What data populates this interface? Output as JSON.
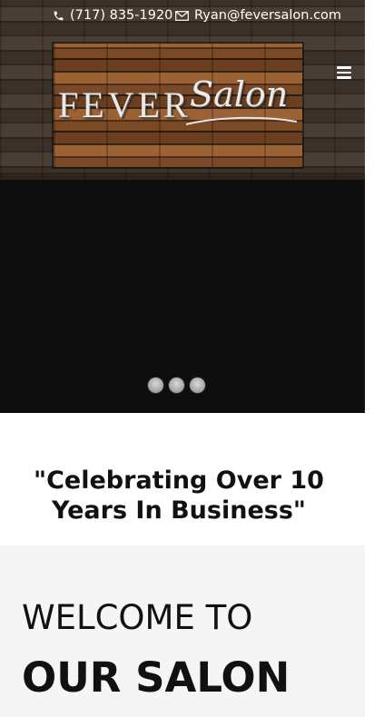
{
  "contact": {
    "phone": "(717) 835-1920",
    "email": "Ryan@feversalon.com"
  },
  "logo": {
    "word_1": "FEVER",
    "word_2": "Salon"
  },
  "icons": {
    "phone": "phone-icon",
    "email": "envelope-icon",
    "menu": "hamburger-menu-icon"
  },
  "slider": {
    "dot_count": 3
  },
  "celebrate": {
    "headline": "\"Celebrating Over 10 Years In Business\""
  },
  "welcome": {
    "line_1": "WELCOME TO",
    "line_2": "OUR SALON"
  },
  "colors": {
    "header_wood": "#3a3028",
    "slider_bg": "#0e0e0e",
    "text": "#111111",
    "welcome_bg": "#f5f5f5"
  }
}
